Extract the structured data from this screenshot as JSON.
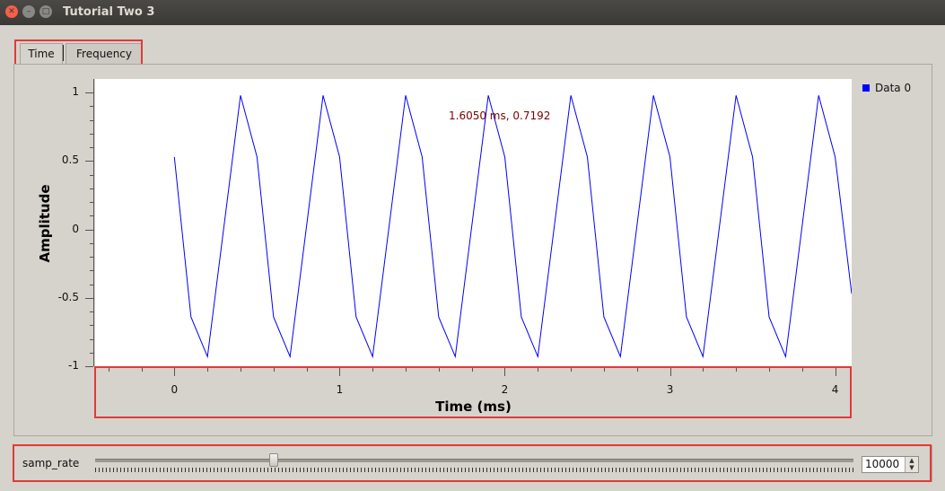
{
  "window": {
    "title": "Tutorial Two 3"
  },
  "tabs": [
    {
      "label": "Time"
    },
    {
      "label": "Frequency"
    }
  ],
  "plot": {
    "readout": "1.6050 ms, 0.7192",
    "legend": "Data 0",
    "line_color": "#0000ff"
  },
  "chart_data": {
    "type": "line",
    "title": "",
    "xlabel": "Time (ms)",
    "ylabel": "Amplitude",
    "xlim": [
      -0.48,
      4.1
    ],
    "ylim": [
      -1,
      1.1
    ],
    "x_ticks": [
      "0",
      "1",
      "2",
      "3",
      "4"
    ],
    "y_ticks": [
      "1",
      "0.5",
      "0",
      "-0.5",
      "-1"
    ],
    "legend_position": "right",
    "series": [
      {
        "name": "Data 0",
        "color": "#0000ff",
        "x": [
          0,
          0.1,
          0.2,
          0.4,
          0.5,
          0.6,
          0.7,
          0.9,
          1.0,
          1.1,
          1.2,
          1.4,
          1.5,
          1.6,
          1.7,
          1.9,
          2.0,
          2.1,
          2.2,
          2.4,
          2.5,
          2.6,
          2.7,
          2.9,
          3.0,
          3.1,
          3.2,
          3.4,
          3.5,
          3.6,
          3.7,
          3.9,
          4.0,
          4.1
        ],
        "y": [
          0.53,
          -0.64,
          -0.93,
          0.98,
          0.53,
          -0.64,
          -0.93,
          0.98,
          0.53,
          -0.64,
          -0.93,
          0.98,
          0.53,
          -0.64,
          -0.93,
          0.98,
          0.53,
          -0.64,
          -0.93,
          0.98,
          0.53,
          -0.64,
          -0.93,
          0.98,
          0.53,
          -0.64,
          -0.93,
          0.98,
          0.53,
          -0.64,
          -0.93,
          0.98,
          0.53,
          -0.47
        ]
      }
    ]
  },
  "controls": {
    "samp_rate_label": "samp_rate",
    "samp_rate_value": "10000",
    "slider_fraction": 0.235
  }
}
